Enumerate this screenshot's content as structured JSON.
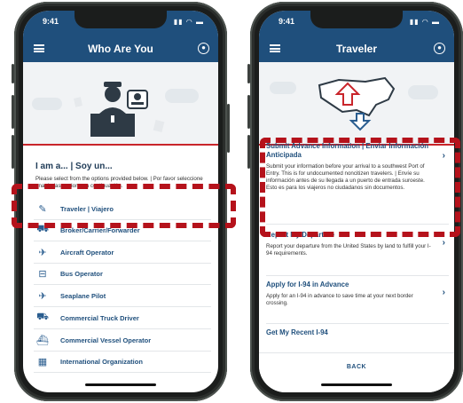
{
  "left_screen": {
    "status_time": "9:41",
    "title": "Who Are You",
    "heading": "I am a... | Soy un...",
    "instructions": "Please select from the options provided below. | Por favor seleccione una de las opciones a continuación.",
    "options": [
      {
        "label": "Traveler | Viajero",
        "icon": "passport-icon",
        "glyph": "✎"
      },
      {
        "label": "Broker/Carrier/Forwarder",
        "icon": "package-icon",
        "glyph": "⛟"
      },
      {
        "label": "Aircraft Operator",
        "icon": "airplane-icon",
        "glyph": "✈"
      },
      {
        "label": "Bus Operator",
        "icon": "bus-icon",
        "glyph": "⊟"
      },
      {
        "label": "Seaplane Pilot",
        "icon": "seaplane-icon",
        "glyph": "✈"
      },
      {
        "label": "Commercial Truck Driver",
        "icon": "truck-icon",
        "glyph": "⛟"
      },
      {
        "label": "Commercial Vessel Operator",
        "icon": "ship-icon",
        "glyph": "⛴"
      },
      {
        "label": "International Organization",
        "icon": "building-icon",
        "glyph": "▦"
      }
    ]
  },
  "right_screen": {
    "status_time": "9:41",
    "title": "Traveler",
    "cards": [
      {
        "title": "Submit Advance Information | Enviar Información Anticipada",
        "description": "Submit your information before your arrival to a southwest Port of Entry. This is for undocumented noncitizen travelers. | Envíe su información antes de su llegada a un puerto de entrada suroeste. Esto es para los viajeros no ciudadanos sin documentos."
      },
      {
        "title": "Report My Departure",
        "description": "Report your departure from the United States by land to fulfill your I-94 requirements."
      },
      {
        "title": "Apply for I-94 in Advance",
        "description": "Apply for an I-94 in advance to save time at your next border crossing."
      },
      {
        "title": "Get My Recent I-94",
        "description": ""
      }
    ],
    "back_label": "BACK"
  },
  "colors": {
    "navbar": "#1f4f7c",
    "accent_red": "#c9252b",
    "highlight_dash": "#b5121b"
  }
}
